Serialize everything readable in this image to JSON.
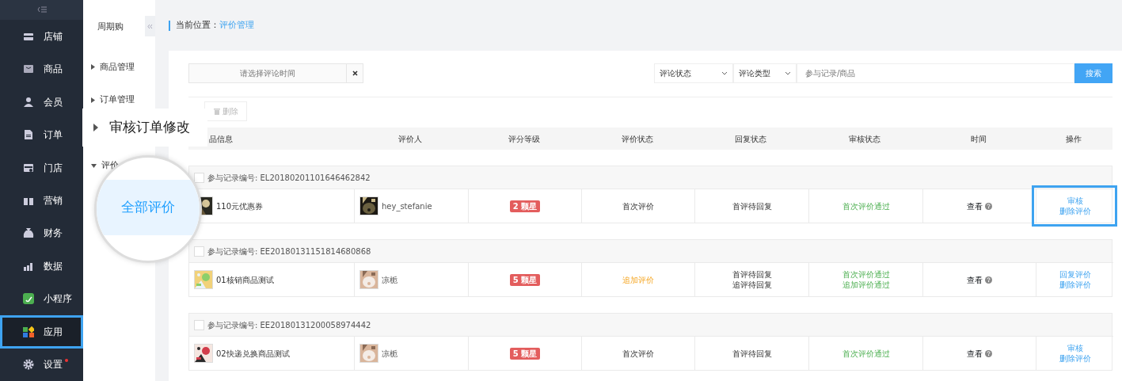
{
  "nav": {
    "items": [
      {
        "label": "店铺",
        "selected": false
      },
      {
        "label": "商品",
        "selected": false
      },
      {
        "label": "会员",
        "selected": false
      },
      {
        "label": "订单",
        "selected": false
      },
      {
        "label": "门店",
        "selected": false
      },
      {
        "label": "营销",
        "selected": false
      },
      {
        "label": "财务",
        "selected": false
      },
      {
        "label": "数据",
        "selected": false
      },
      {
        "label": "小程序",
        "selected": false
      },
      {
        "label": "应用",
        "selected": true,
        "highlighted": true
      },
      {
        "label": "设置",
        "selected": false,
        "dot": true
      }
    ]
  },
  "subnav": {
    "title": "周期购",
    "items": [
      {
        "label": "商品管理",
        "expanded": false
      },
      {
        "label": "订单管理",
        "expanded": false
      },
      {
        "label": "评价",
        "expanded": true
      }
    ]
  },
  "callout": {
    "text": "审核订单修改"
  },
  "magnifier": {
    "text": "全部评价"
  },
  "breadcrumb": {
    "label": "当前位置：",
    "current": "评价管理"
  },
  "filters": {
    "date_placeholder": "请选择评论时间",
    "selects": [
      "评论状态",
      "评论类型"
    ],
    "search_placeholder": "参与记录/商品",
    "search_button": "搜索"
  },
  "delete_button": "删除",
  "table": {
    "columns": [
      "品信息",
      "评价人",
      "评分等级",
      "评价状态",
      "回复状态",
      "审核状态",
      "时间",
      "操作"
    ],
    "groups": [
      {
        "record": "参与记录编号: EL20180201101646462842",
        "checked": false,
        "product": "110元优惠券",
        "reviewer": "hey_stefanie",
        "rating": "2 颗星",
        "eval_status": {
          "text": "首次评价",
          "kind": "first"
        },
        "reply_status": [
          "首评待回复"
        ],
        "audit_status": [
          "首次评价通过"
        ],
        "time": "查看",
        "actions": [
          "审核",
          "删除评价"
        ],
        "highlighted": true
      },
      {
        "record": "参与记录编号: EE20180131151814680868",
        "checked": false,
        "product": "01核销商品测试",
        "reviewer": "凉栀",
        "rating": "5 颗星",
        "eval_status": {
          "text": "追加评价",
          "kind": "append"
        },
        "reply_status": [
          "首评待回复",
          "追评待回复"
        ],
        "audit_status": [
          "首次评价通过",
          "追加评价通过"
        ],
        "time": "查看",
        "actions": [
          "回复评价",
          "删除评价"
        ],
        "highlighted": false
      },
      {
        "record": "参与记录编号: EE20180131200058974442",
        "checked": false,
        "product": "02快递兑换商品测试",
        "reviewer": "凉栀",
        "rating": "5 颗星",
        "eval_status": {
          "text": "首次评价",
          "kind": "first"
        },
        "reply_status": [
          "首评待回复"
        ],
        "audit_status": [
          "首次评价通过"
        ],
        "time": "查看",
        "actions": [
          "审核",
          "删除评价"
        ],
        "highlighted": false
      }
    ]
  }
}
